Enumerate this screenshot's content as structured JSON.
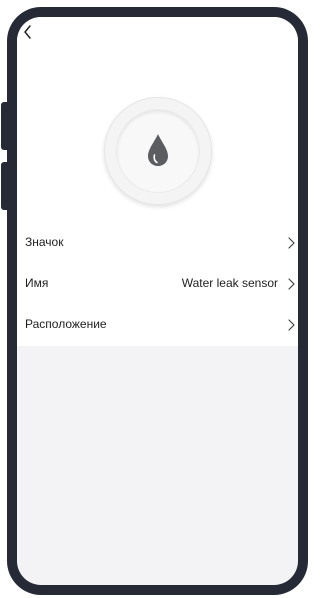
{
  "header": {
    "back_icon": "chevron-left-icon"
  },
  "device": {
    "icon": "water-drop-icon",
    "icon_color": "#5b5d60"
  },
  "settings": {
    "icon_row": {
      "label": "Значок",
      "chevron": "chevron-right-icon"
    },
    "name_row": {
      "label": "Имя",
      "value": "Water leak sensor",
      "chevron": "chevron-right-icon"
    },
    "location_row": {
      "label": "Расположение",
      "chevron": "chevron-right-icon"
    }
  },
  "colors": {
    "frame": "#262a37",
    "screen_bg": "#f3f3f5",
    "card_bg": "#ffffff",
    "text": "#1f1f1f"
  }
}
